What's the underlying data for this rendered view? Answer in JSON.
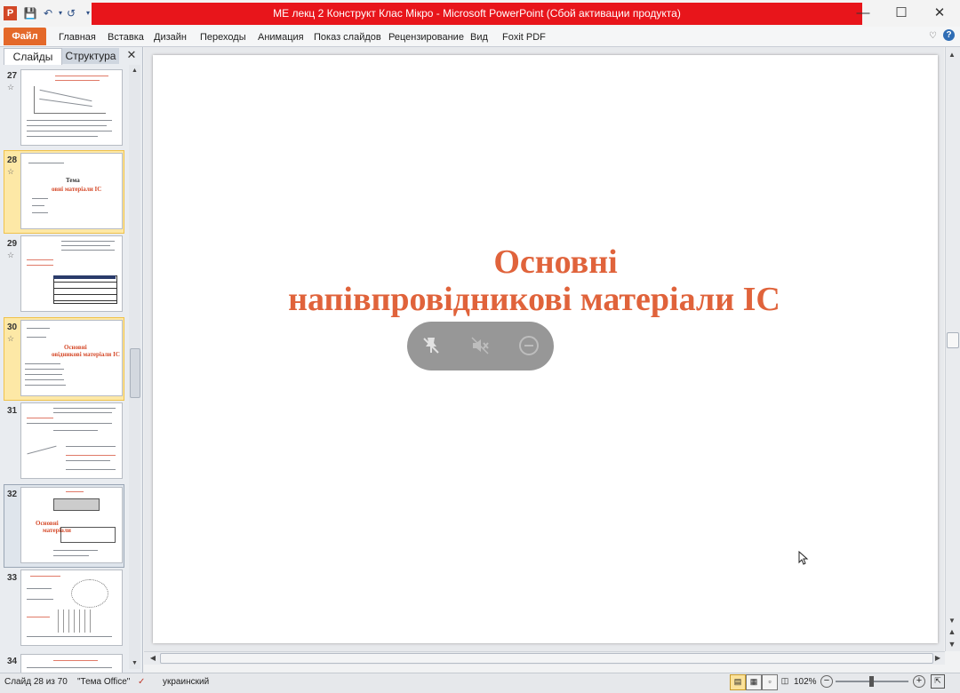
{
  "window": {
    "title": "МЕ лекц 2 Конструкт Клас Мікро  -  Microsoft PowerPoint (Сбой активации продукта)",
    "app_icon": "P",
    "minimize": "—",
    "maximize": "☐",
    "close": "✕"
  },
  "ribbon": {
    "file": "Файл",
    "tabs": [
      "Главная",
      "Вставка",
      "Дизайн",
      "Переходы",
      "Анимация",
      "Показ слайдов",
      "Рецензирование",
      "Вид",
      "Foxit PDF"
    ],
    "help": "?"
  },
  "panel": {
    "tabs": [
      "Слайды",
      "Структура"
    ],
    "close": "✕",
    "thumbs": [
      {
        "num": "27",
        "title": "",
        "highlight": "none"
      },
      {
        "num": "28",
        "title": "Тема",
        "subtitle": "овні  матеріали IC",
        "highlight": "selected"
      },
      {
        "num": "29",
        "title": "",
        "highlight": "none"
      },
      {
        "num": "30",
        "title": "Основні",
        "subtitle": "овідникові матеріали IC",
        "highlight": "selected"
      },
      {
        "num": "31",
        "title": "",
        "highlight": "none"
      },
      {
        "num": "32",
        "title": "Основні",
        "subtitle": "матеріали",
        "highlight": "current"
      },
      {
        "num": "33",
        "title": "",
        "highlight": "none"
      },
      {
        "num": "34",
        "title": "",
        "highlight": "none"
      }
    ]
  },
  "slide": {
    "title_line1": "Основні",
    "title_line2": "напівпровідникові матеріали IC",
    "title_color": "#e0633b"
  },
  "overlay": {
    "icons": [
      "pin-off-icon",
      "volume-mute-icon",
      "minus-circle-icon"
    ]
  },
  "status": {
    "slide_info": "Слайд 28 из 70",
    "theme": "\"Тема Office\"",
    "language": "украинский",
    "zoom": "102%"
  }
}
